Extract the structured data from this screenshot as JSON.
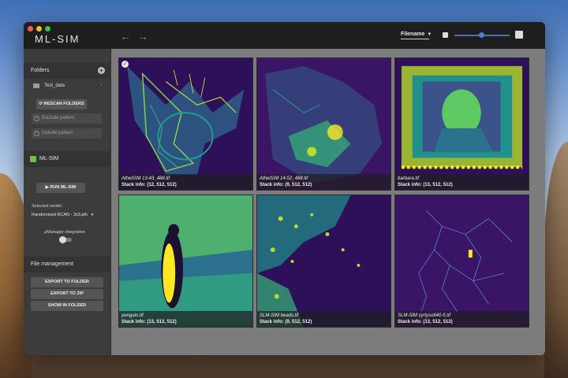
{
  "app": {
    "title": "ML-SIM"
  },
  "toolbar": {
    "back_icon": "←",
    "forward_icon": "→",
    "sort_label": "Filename",
    "thumbnail_size_percent": 50
  },
  "sidebar": {
    "folders_header": "Folders",
    "folder_items": [
      {
        "label": "Test_data"
      }
    ],
    "rescan_label": "RESCAN FOLDERS",
    "exclude_placeholder": "Exclude pattern",
    "include_placeholder": "Include pattern",
    "mlsim_header": "ML-SIM",
    "run_label": "RUN ML-SIM",
    "selected_model_label": "Selected model",
    "selected_model_value": "Randomised RCAN - 3x3.pth",
    "umanager_label": "µManager integration",
    "umanager_enabled": false,
    "file_mgmt_header": "File management",
    "export_folder_label": "EXPORT TO FOLDER",
    "export_zip_label": "EXPORT TO ZIP",
    "show_folder_label": "SHOW IN FOLDER"
  },
  "gallery": {
    "tiles": [
      {
        "filename": "AtheiSIM 13-43_488.tif",
        "info": "Stack info: (12, 512, 512)",
        "selected": true
      },
      {
        "filename": "AtheiSIM 14-52_488.tif",
        "info": "Stack info: (9, 512, 512)",
        "selected": false
      },
      {
        "filename": "barbara.tif",
        "info": "Stack info: (13, 512, 512)",
        "selected": false
      },
      {
        "filename": "penguin.tif",
        "info": "Stack info: (13, 512, 512)",
        "selected": false
      },
      {
        "filename": "SLM-SIM beads.tif",
        "info": "Stack info: (9, 512, 512)",
        "selected": false
      },
      {
        "filename": "SLM-SIM syrlyso640-5.tif",
        "info": "Stack info: (13, 512, 512)",
        "selected": false
      }
    ]
  },
  "colors": {
    "accent": "#4f7fd8",
    "viridis_dark": "#2d0f5a",
    "viridis_mid": "#21918c",
    "viridis_bright": "#fde725"
  }
}
